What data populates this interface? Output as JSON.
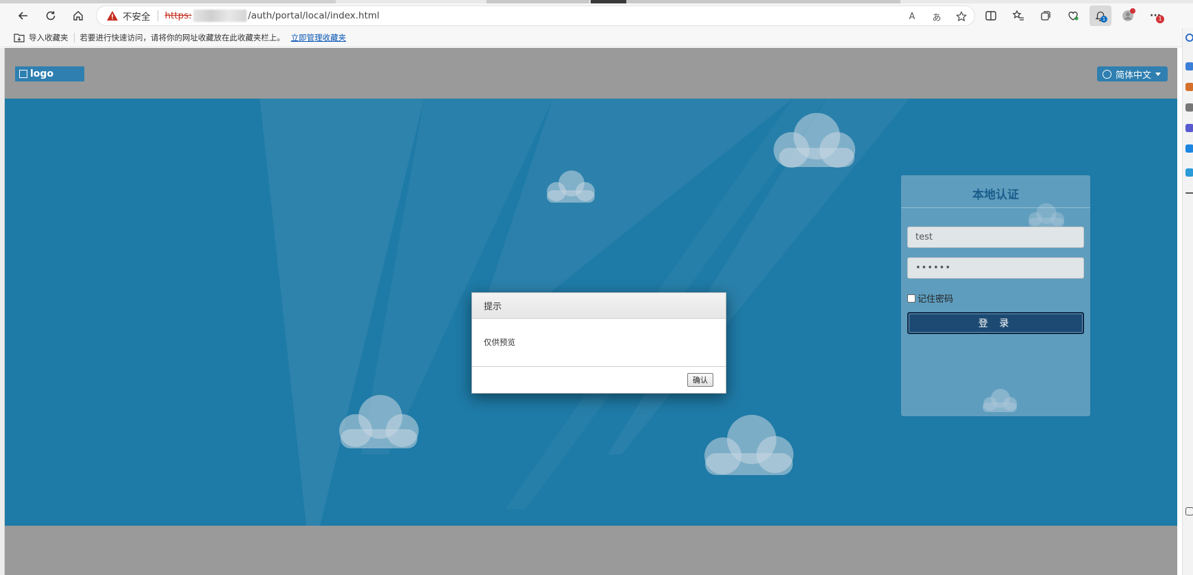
{
  "browser": {
    "insecure_label": "不安全",
    "url_scheme": "https:",
    "url_path": "/auth/portal/local/index.html",
    "read_aloud_label": "A",
    "translate_label": "あ",
    "more_label": "···",
    "notifications_count": "1",
    "extension_badge": "1"
  },
  "bookmarks_bar": {
    "import_label": "导入收藏夹",
    "hint_text": "若要进行快速访问，请将你的网址收藏放在此收藏夹栏上。",
    "manage_link": "立即管理收藏夹"
  },
  "site": {
    "logo_text": "logo",
    "language_button": "简体中文",
    "brand_color": "#1e7aa6"
  },
  "login": {
    "title": "本地认证",
    "username_value": "test",
    "password_value": "••••••",
    "remember_label": "记住密码",
    "login_button": "登 录"
  },
  "dialog": {
    "title": "提示",
    "message": "仅供预览",
    "ok_button": "确认"
  }
}
